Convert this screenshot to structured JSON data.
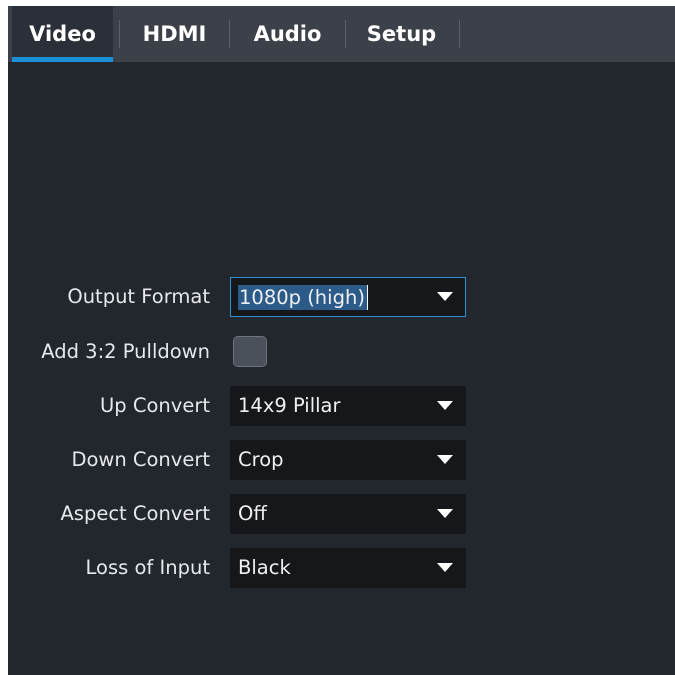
{
  "tabs": [
    {
      "label": "Video",
      "active": true
    },
    {
      "label": "HDMI",
      "active": false
    },
    {
      "label": "Audio",
      "active": false
    },
    {
      "label": "Setup",
      "active": false
    }
  ],
  "settings": {
    "output_format": {
      "label": "Output Format",
      "value": "1080p (high)"
    },
    "pulldown": {
      "label": "Add 3:2 Pulldown",
      "checked": false
    },
    "up_convert": {
      "label": "Up Convert",
      "value": "14x9 Pillar"
    },
    "down_convert": {
      "label": "Down Convert",
      "value": "Crop"
    },
    "aspect_convert": {
      "label": "Aspect Convert",
      "value": "Off"
    },
    "loss_of_input": {
      "label": "Loss of Input",
      "value": "Black"
    }
  },
  "colors": {
    "background": "#22262d",
    "tab_bar": "#3c4149",
    "accent": "#1a8fd6",
    "select_bg": "#15171b",
    "selection_highlight": "#2d5b89"
  }
}
